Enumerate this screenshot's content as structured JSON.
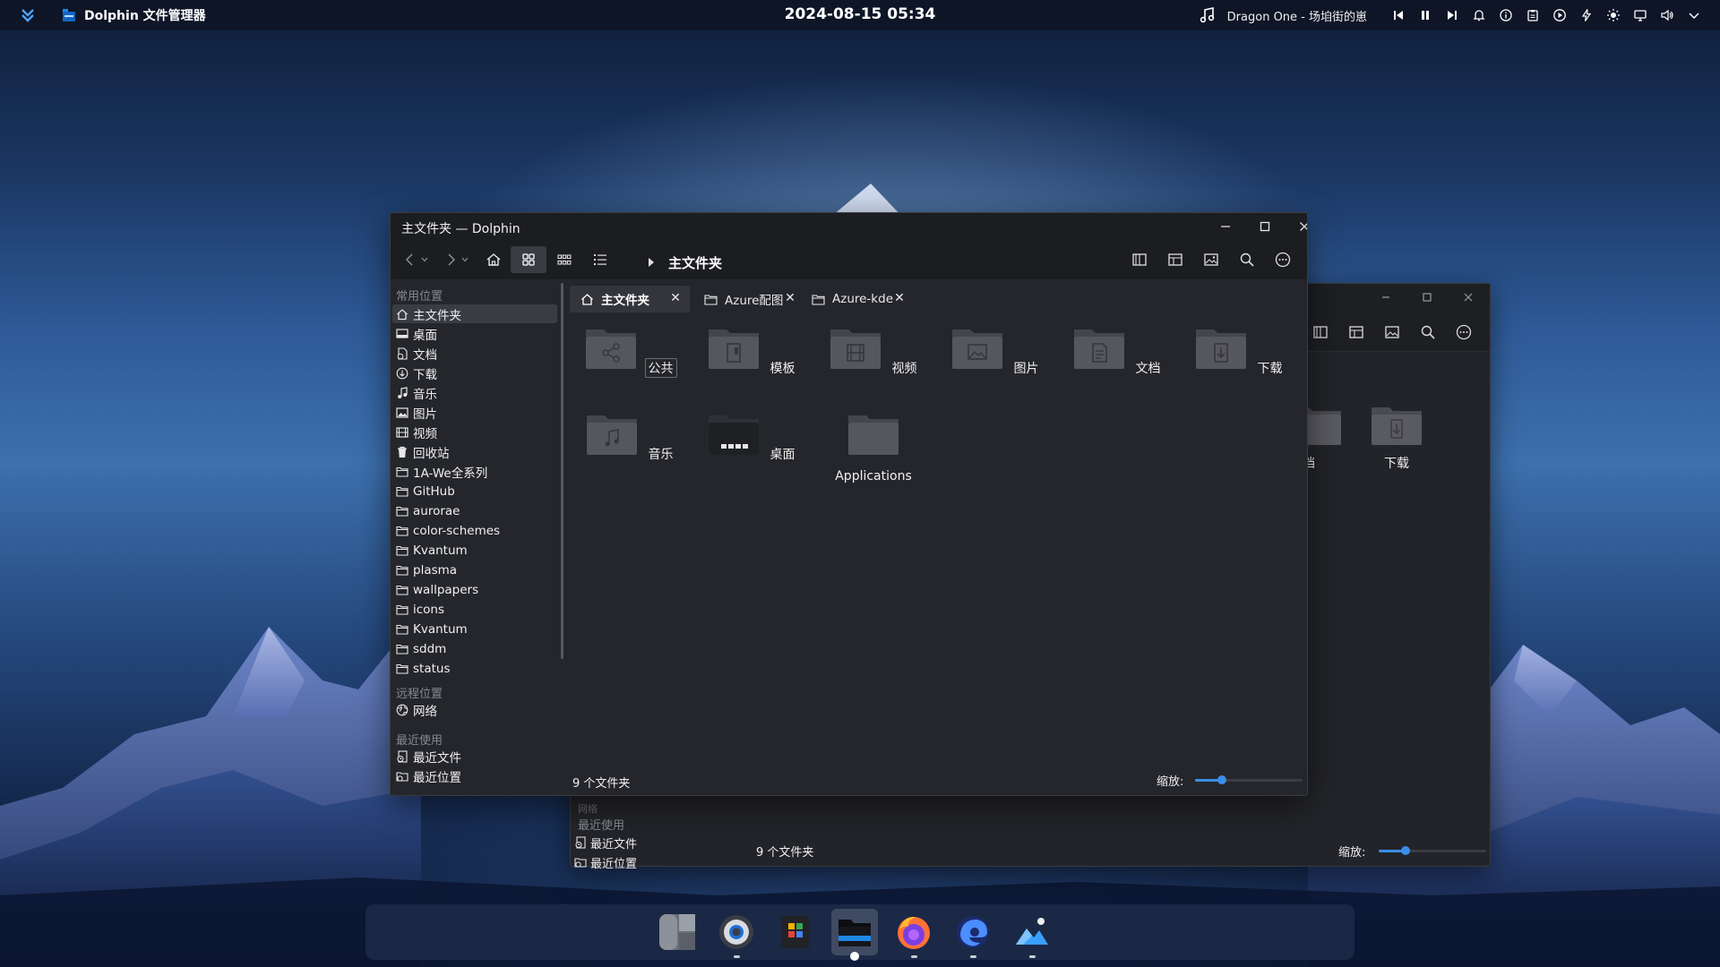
{
  "top_panel": {
    "app_icon": "dolphin-app-icon",
    "app_title": "Dolphin 文件管理器",
    "clock": "2024-08-15 05:34",
    "media_title": "Dragon One - 场垍街的崽",
    "tray_icons": [
      "previous-track-icon",
      "pause-icon",
      "next-track-icon",
      "bell-icon",
      "info-icon",
      "clipboard-icon",
      "play-circle-icon",
      "power-bolt-icon",
      "brightness-icon",
      "display-icon",
      "volume-icon",
      "chevron-down-icon"
    ]
  },
  "window": {
    "title": "主文件夹 — Dolphin",
    "breadcrumb": "主文件夹",
    "tabs": [
      {
        "label": "主文件夹",
        "icon": "home-icon",
        "active": true
      },
      {
        "label": "Azure配图",
        "icon": "folder-icon",
        "active": false
      },
      {
        "label": "Azure-kde",
        "icon": "folder-icon",
        "active": false
      }
    ],
    "tab_close": "✕",
    "sidebar": {
      "sections": [
        {
          "title": "常用位置",
          "items": [
            {
              "label": "主文件夹",
              "icon": "home-icon",
              "selected": true
            },
            {
              "label": "桌面",
              "icon": "desktop-icon"
            },
            {
              "label": "文档",
              "icon": "document-icon"
            },
            {
              "label": "下载",
              "icon": "download-icon"
            },
            {
              "label": "音乐",
              "icon": "music-icon"
            },
            {
              "label": "图片",
              "icon": "picture-icon"
            },
            {
              "label": "视频",
              "icon": "video-icon"
            },
            {
              "label": "回收站",
              "icon": "trash-icon"
            },
            {
              "label": "1A-We全系列",
              "icon": "folder-icon"
            },
            {
              "label": "GitHub",
              "icon": "folder-icon"
            },
            {
              "label": "aurorae",
              "icon": "folder-icon"
            },
            {
              "label": "color-schemes",
              "icon": "folder-icon"
            },
            {
              "label": "Kvantum",
              "icon": "folder-icon"
            },
            {
              "label": "plasma",
              "icon": "folder-icon"
            },
            {
              "label": "wallpapers",
              "icon": "folder-icon"
            },
            {
              "label": "icons",
              "icon": "folder-icon"
            },
            {
              "label": "Kvantum",
              "icon": "folder-icon"
            },
            {
              "label": "sddm",
              "icon": "folder-icon"
            },
            {
              "label": "status",
              "icon": "folder-icon"
            }
          ]
        },
        {
          "title": "远程位置",
          "items": [
            {
              "label": "网络",
              "icon": "network-icon"
            }
          ]
        },
        {
          "title": "最近使用",
          "items": [
            {
              "label": "最近文件",
              "icon": "recent-files-icon"
            },
            {
              "label": "最近位置",
              "icon": "recent-locations-icon"
            }
          ]
        }
      ]
    },
    "folders": [
      {
        "label": "公共",
        "emblem": "share-emblem"
      },
      {
        "label": "模板",
        "emblem": "template-emblem"
      },
      {
        "label": "视频",
        "emblem": "video-emblem"
      },
      {
        "label": "图片",
        "emblem": "picture-emblem"
      },
      {
        "label": "文档",
        "emblem": "document-emblem"
      },
      {
        "label": "下载",
        "emblem": "download-emblem"
      },
      {
        "label": "音乐",
        "emblem": "music-emblem"
      },
      {
        "label": "桌面",
        "emblem": "desktop-emblem"
      },
      {
        "label": "Applications",
        "emblem": "none"
      }
    ],
    "status": "9 个文件夹",
    "zoom_label": "缩放:",
    "zoom_level": 0.25
  },
  "back_window": {
    "folders": [
      {
        "label": "档",
        "emblem": "document-emblem"
      },
      {
        "label": "下载",
        "emblem": "download-emblem"
      }
    ],
    "sidebar_partial": {
      "cut_label": "网络",
      "section": "最近使用",
      "items": [
        {
          "label": "最近文件",
          "icon": "recent-files-icon"
        },
        {
          "label": "最近位置",
          "icon": "recent-locations-icon"
        }
      ]
    },
    "status": "9 个文件夹",
    "zoom_label": "缩放:",
    "zoom_level": 0.25
  },
  "dock": {
    "items": [
      {
        "name": "workspace-overview",
        "active": false,
        "running": false
      },
      {
        "name": "system-settings",
        "active": false,
        "running": true
      },
      {
        "name": "app-store",
        "active": false,
        "running": false
      },
      {
        "name": "dolphin-file-manager",
        "active": true,
        "running": true
      },
      {
        "name": "firefox",
        "active": false,
        "running": true
      },
      {
        "name": "edge-browser",
        "active": false,
        "running": true
      },
      {
        "name": "image-viewer",
        "active": false,
        "running": true
      }
    ]
  },
  "colors": {
    "accent": "#3a8ee6",
    "window_bg": "#25262b",
    "titlebar_bg": "#1c1d21",
    "selection_bg": "#3a3c44"
  }
}
